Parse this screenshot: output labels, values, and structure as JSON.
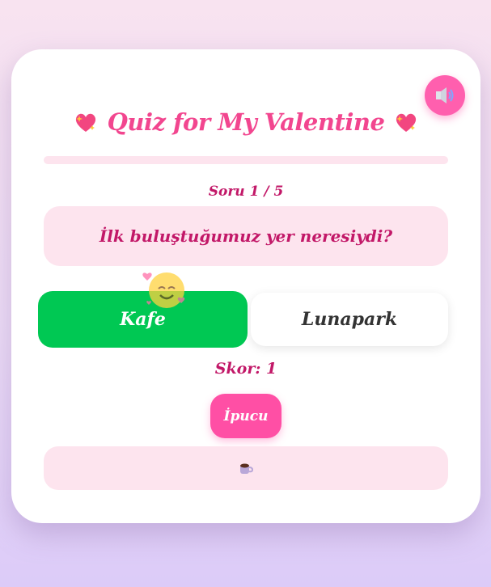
{
  "title": "Quiz for My Valentine",
  "progress": {
    "fraction": 0.0
  },
  "question_counter": "Soru 1 / 5",
  "question": "İlk buluştuğumuz yer neresiydi?",
  "answers": [
    {
      "label": "Kafe",
      "state": "selected-correct",
      "color": "#00c853"
    },
    {
      "label": "Lunapark",
      "state": "idle"
    }
  ],
  "score_label": "Skor: 1",
  "hint_button_label": "İpucu",
  "hint_icon": "coffee-cup-icon",
  "colors": {
    "accent": "#ff4fa5",
    "title": "#f2468f",
    "text_dark_pink": "#c21868",
    "soft_pink": "#fde4ee",
    "correct_green": "#00c853"
  },
  "icons": {
    "sound": "speaker-icon",
    "title_decor": "sparkling-heart-icon",
    "reaction": "smiling-hearts-face-icon"
  }
}
